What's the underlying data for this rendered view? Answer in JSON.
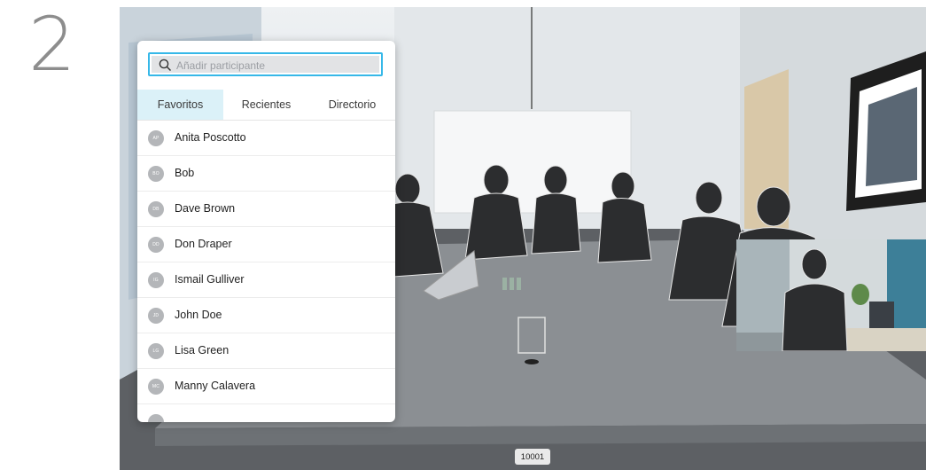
{
  "step": {
    "number": "2"
  },
  "panel": {
    "search": {
      "placeholder": "Añadir participante",
      "icon": "search-icon"
    },
    "tabs": [
      {
        "label": "Favoritos",
        "active": true
      },
      {
        "label": "Recientes",
        "active": false
      },
      {
        "label": "Directorio",
        "active": false
      }
    ],
    "contacts": [
      {
        "initials": "AP",
        "name": "Anita Poscotto"
      },
      {
        "initials": "BO",
        "name": "Bob"
      },
      {
        "initials": "DB",
        "name": "Dave Brown"
      },
      {
        "initials": "DD",
        "name": "Don Draper"
      },
      {
        "initials": "IG",
        "name": "Ismail Gulliver"
      },
      {
        "initials": "JD",
        "name": "John Doe"
      },
      {
        "initials": "LG",
        "name": "Lisa Green"
      },
      {
        "initials": "MC",
        "name": "Manny Calavera"
      }
    ]
  },
  "call": {
    "number": "10001"
  },
  "colors": {
    "accent": "#36b8e8",
    "active_tab": "#dbf1f8",
    "avatar": "#b4b6b9"
  }
}
